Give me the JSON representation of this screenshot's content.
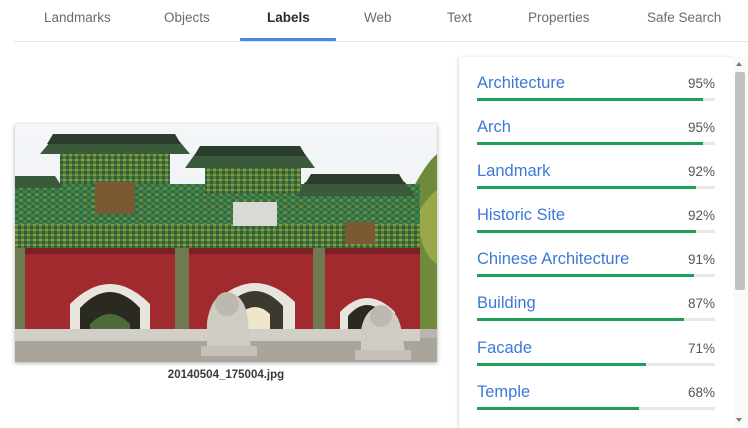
{
  "tabs": [
    {
      "label": "Landmarks",
      "active": false
    },
    {
      "label": "Objects",
      "active": false
    },
    {
      "label": "Labels",
      "active": true
    },
    {
      "label": "Web",
      "active": false
    },
    {
      "label": "Text",
      "active": false
    },
    {
      "label": "Properties",
      "active": false
    },
    {
      "label": "Safe Search",
      "active": false
    }
  ],
  "image": {
    "filename": "20140504_175004.jpg"
  },
  "labels": [
    {
      "name": "Architecture",
      "score": "95%",
      "fraction": 0.95
    },
    {
      "name": "Arch",
      "score": "95%",
      "fraction": 0.95
    },
    {
      "name": "Landmark",
      "score": "92%",
      "fraction": 0.92
    },
    {
      "name": "Historic Site",
      "score": "92%",
      "fraction": 0.92
    },
    {
      "name": "Chinese Architecture",
      "score": "91%",
      "fraction": 0.91
    },
    {
      "name": "Building",
      "score": "87%",
      "fraction": 0.87
    },
    {
      "name": "Facade",
      "score": "71%",
      "fraction": 0.71
    },
    {
      "name": "Temple",
      "score": "68%",
      "fraction": 0.68
    }
  ],
  "colors": {
    "accent": "#4a86e8",
    "label_text": "#3c78d8",
    "bar": "#1e9e55",
    "bar_track": "#e8e8e8"
  }
}
